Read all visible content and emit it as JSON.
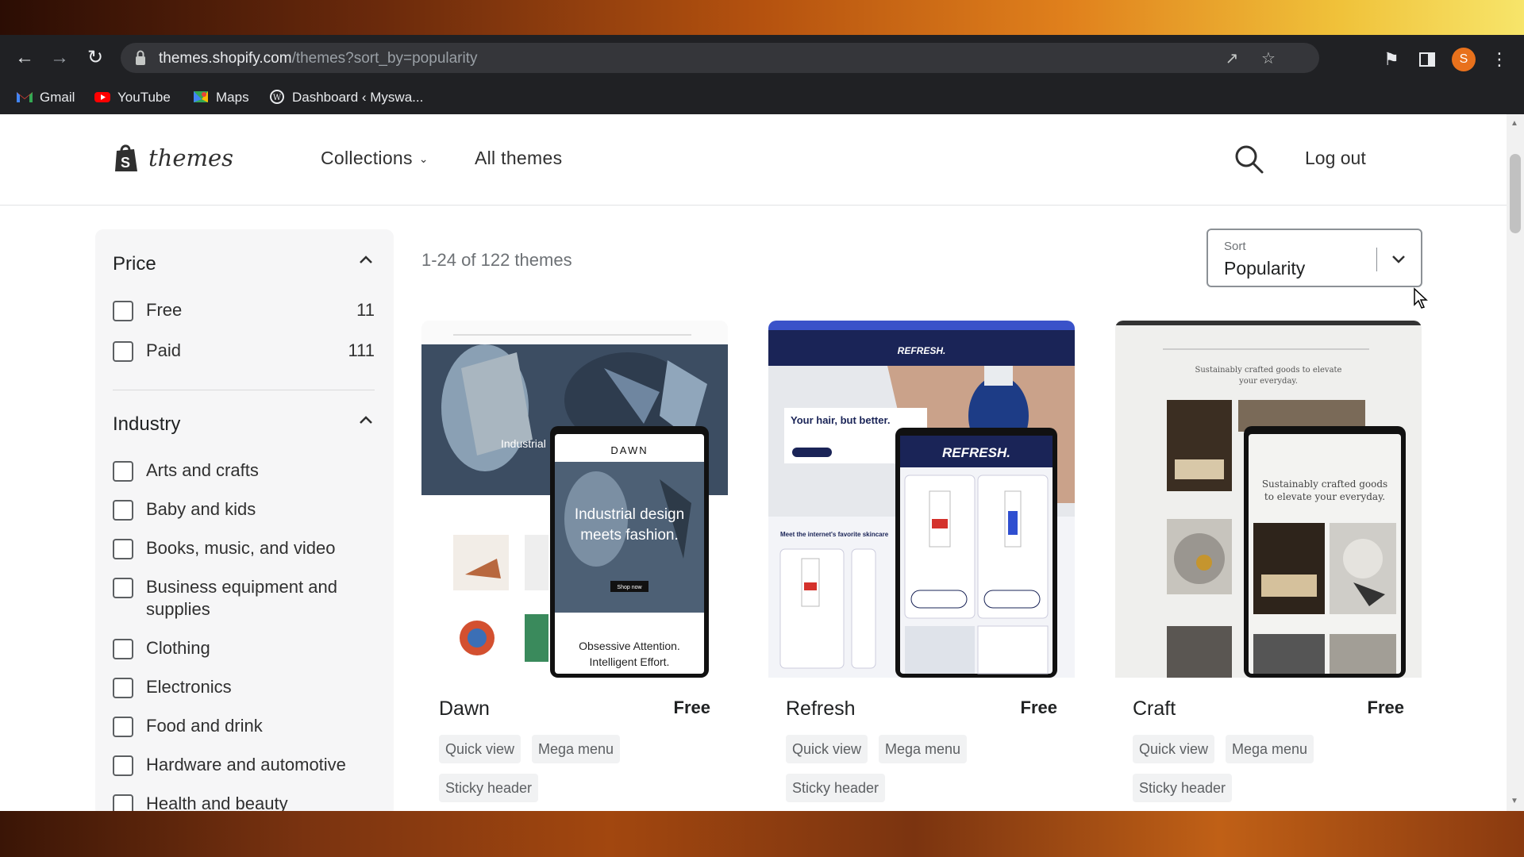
{
  "browser": {
    "url_host": "themes.shopify.com",
    "url_path": "/themes?sort_by=popularity",
    "profile_initial": "S",
    "bookmarks": [
      {
        "label": "Gmail",
        "icon": "gmail-icon"
      },
      {
        "label": "YouTube",
        "icon": "youtube-icon"
      },
      {
        "label": "Maps",
        "icon": "maps-icon"
      },
      {
        "label": "Dashboard ‹ Myswa...",
        "icon": "wordpress-icon"
      }
    ]
  },
  "header": {
    "logo_text": "themes",
    "nav": {
      "collections": "Collections",
      "all_themes": "All themes"
    },
    "logout": "Log out"
  },
  "filters": {
    "price": {
      "title": "Price",
      "options": [
        {
          "label": "Free",
          "count": "11"
        },
        {
          "label": "Paid",
          "count": "111"
        }
      ]
    },
    "industry": {
      "title": "Industry",
      "options": [
        {
          "label": "Arts and crafts"
        },
        {
          "label": "Baby and kids"
        },
        {
          "label": "Books, music, and video"
        },
        {
          "label": "Business equipment and supplies"
        },
        {
          "label": "Clothing"
        },
        {
          "label": "Electronics"
        },
        {
          "label": "Food and drink"
        },
        {
          "label": "Hardware and automotive"
        },
        {
          "label": "Health and beauty"
        }
      ]
    }
  },
  "results": {
    "count_text": "1-24 of 122 themes",
    "sort_label": "Sort",
    "sort_value": "Popularity"
  },
  "themes": [
    {
      "name": "Dawn",
      "price": "Free",
      "tags": [
        "Quick view",
        "Mega menu",
        "Sticky header"
      ],
      "preview": {
        "brand": "DAWN",
        "headline_1": "Industrial design",
        "headline_2": "meets fashion.",
        "sub": "Obsessive Attention.",
        "sub2": "Intelligent Effort.",
        "cta": "Shop now",
        "overlay": "Industrial"
      }
    },
    {
      "name": "Refresh",
      "price": "Free",
      "tags": [
        "Quick view",
        "Mega menu",
        "Sticky header"
      ],
      "preview": {
        "brand": "REFRESH.",
        "headline": "Your hair, but better.",
        "section": "Meet the internet's favorite skincare"
      }
    },
    {
      "name": "Craft",
      "price": "Free",
      "tags": [
        "Quick view",
        "Mega menu",
        "Sticky header"
      ],
      "preview": {
        "tagline_1": "Sustainably crafted goods to elevate",
        "tagline_2": "your everyday.",
        "mobile_1": "Sustainably crafted goods",
        "mobile_2": "to elevate your everyday."
      }
    }
  ]
}
